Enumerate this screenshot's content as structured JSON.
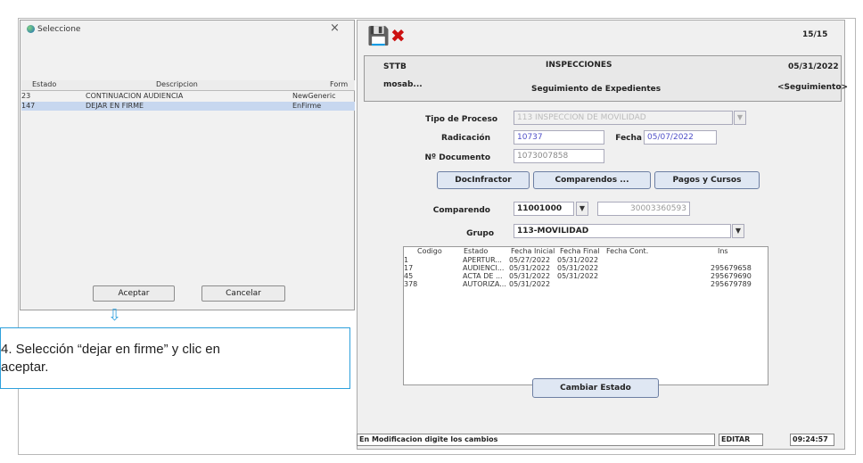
{
  "dialog": {
    "title": "Seleccione",
    "close": "×",
    "columns": [
      "Estado",
      "Descripcion",
      "Form"
    ],
    "rows": [
      {
        "estado": "23",
        "descripcion": "CONTINUACION AUDIENCIA",
        "form": "NewGeneric"
      },
      {
        "estado": "147",
        "descripcion": "DEJAR EN FIRME",
        "form": "EnFirme",
        "selected": true
      }
    ],
    "accept": "Aceptar",
    "cancel": "Cancelar"
  },
  "annotation": {
    "arrow": "⇩",
    "text_line1": "4. Selección “dejar en firme” y clic en",
    "text_line2": "aceptar."
  },
  "window": {
    "counter": "15/15",
    "icons": [
      "save-icon",
      "delete-icon"
    ],
    "header": {
      "org": "STTB",
      "module": "INSPECCIONES",
      "date": "05/31/2022",
      "user": "mosab...",
      "subtitle": "Seguimiento de Expedientes",
      "tag": "<Seguimiento>"
    },
    "form": {
      "tipo_label": "Tipo de Proceso",
      "tipo_value": "113 INSPECCION DE MOVILIDAD",
      "radicacion_label": "Radicación",
      "radicacion_value": "10737",
      "fecha_label": "Fecha",
      "fecha_value": "05/07/2022",
      "documento_label": "Nº Documento",
      "documento_value": "1073007858",
      "btn_infractor": "DocInfractor",
      "btn_comparendos": "Comparendos ...",
      "btn_pagos": "Pagos y Cursos",
      "comparendo_label": "Comparendo",
      "comparendo_value": "11001000",
      "comparendo_number": "30003360593",
      "grupo_label": "Grupo",
      "grupo_value": "113-MOVILIDAD"
    },
    "grid": {
      "columns": [
        "Codigo",
        "Estado",
        "Fecha Inicial",
        "Fecha Final",
        "Fecha Cont.",
        "Ins"
      ],
      "rows": [
        [
          "1",
          "APERTUR...",
          "05/27/2022",
          "05/31/2022",
          "",
          ""
        ],
        [
          "17",
          "AUDIENCI...",
          "05/31/2022",
          "05/31/2022",
          "",
          "295679658"
        ],
        [
          "45",
          "ACTA DE ...",
          "05/31/2022",
          "05/31/2022",
          "",
          "295679690"
        ],
        [
          "378",
          "AUTORIZA...",
          "05/31/2022",
          "",
          "",
          "295679789"
        ]
      ]
    },
    "btn_cambiar": "Cambiar Estado",
    "status": {
      "message": "En Modificacion digite los cambios",
      "mode": "EDITAR",
      "time": "09:24:57"
    }
  }
}
